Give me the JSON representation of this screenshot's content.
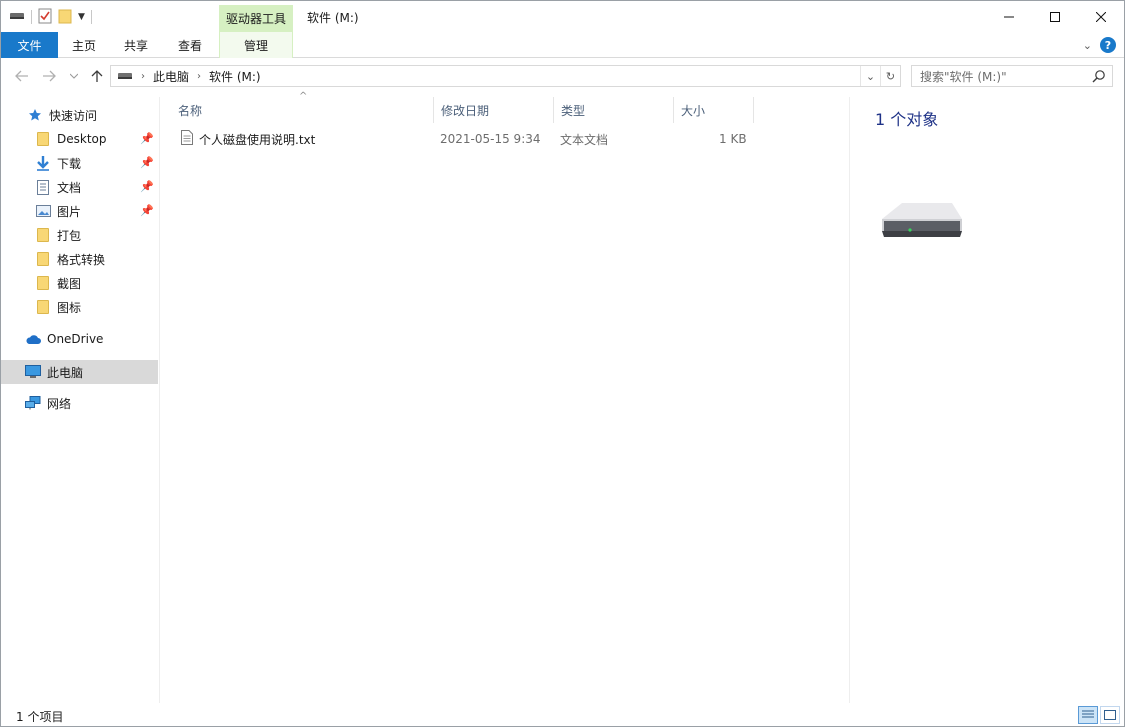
{
  "titlebar": {
    "context_tab_group": "驱动器工具",
    "window_title": "软件 (M:)"
  },
  "ribbon": {
    "tabs": [
      {
        "label": "文件"
      },
      {
        "label": "主页"
      },
      {
        "label": "共享"
      },
      {
        "label": "查看"
      },
      {
        "label": "管理"
      }
    ]
  },
  "address": {
    "crumbs": [
      "此电脑",
      "软件 (M:)"
    ]
  },
  "search": {
    "placeholder": "搜索\"软件 (M:)\""
  },
  "navpane": {
    "quick_access": "快速访问",
    "items": [
      {
        "label": "Desktop",
        "icon": "folder-icon",
        "pinned": true
      },
      {
        "label": "下载",
        "icon": "download-icon",
        "pinned": true
      },
      {
        "label": "文档",
        "icon": "document-icon",
        "pinned": true
      },
      {
        "label": "图片",
        "icon": "picture-icon",
        "pinned": true
      },
      {
        "label": "打包",
        "icon": "folder-icon",
        "pinned": false
      },
      {
        "label": "格式转换",
        "icon": "folder-icon",
        "pinned": false
      },
      {
        "label": "截图",
        "icon": "folder-icon",
        "pinned": false
      },
      {
        "label": "图标",
        "icon": "folder-icon",
        "pinned": false
      }
    ],
    "onedrive": "OneDrive",
    "this_pc": "此电脑",
    "network": "网络"
  },
  "filelist": {
    "columns": [
      "名称",
      "修改日期",
      "类型",
      "大小"
    ],
    "rows": [
      {
        "name": "个人磁盘使用说明.txt",
        "modified": "2021-05-15 9:34",
        "type": "文本文档",
        "size": "1 KB"
      }
    ]
  },
  "details": {
    "count": "1 个对象"
  },
  "statusbar": {
    "items": "1 个项目"
  }
}
